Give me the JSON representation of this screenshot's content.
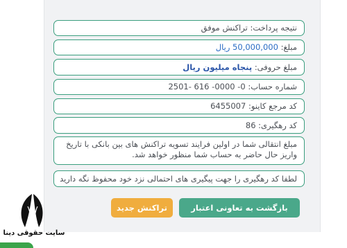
{
  "receipt": {
    "result": {
      "label": "نتیجه پرداخت:",
      "value": "تراکنش موفق"
    },
    "amount": {
      "label": "مبلغ:",
      "value": "50,000,000",
      "unit": "ریال"
    },
    "amount_words": {
      "label": "مبلغ حروفی:",
      "value": "پنجاه میلیون ریال"
    },
    "account": {
      "label": "شماره حساب:",
      "value": "0- 0000- 616 -2501"
    },
    "reference": {
      "label": "کد مرجع کاینو:",
      "value": "6455007"
    },
    "tracking": {
      "label": "کد رهگیری:",
      "value": "86"
    },
    "notice": "مبلغ انتقالی شما در اولین فرایند تسویه تراکنش های بین بانکی با تاریخ واریز حال حاضر به حساب شما منظور خواهد شد.",
    "advice": "لطفا کد رهگیری را جهت پیگیری های احتمالی نزد خود محفوظ نگه دارید"
  },
  "actions": {
    "back_label": "بازگشت به تعاونی اعتبار",
    "new_label": "تراکنش جدید"
  },
  "watermark": {
    "text": "سایت حقوقی دینا"
  },
  "colors": {
    "border": "#3a9e7e",
    "back_button": "#4aa88a",
    "new_button": "#f0ad3e",
    "amount_value": "#2a6cc4",
    "watermark_base": "#3aa44a"
  }
}
